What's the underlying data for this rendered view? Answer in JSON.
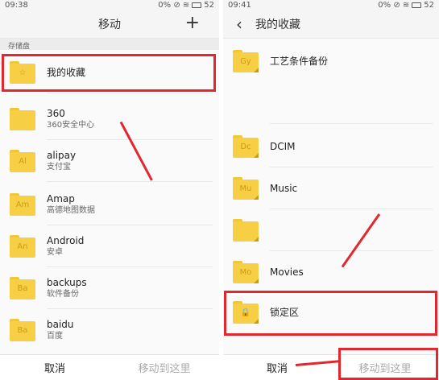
{
  "left": {
    "status": {
      "time": "09:38",
      "icons": "0% ⊘ ≋",
      "battery": "52"
    },
    "title": "移动",
    "add_icon": "+",
    "breadcrumb": "存储盘",
    "items": [
      {
        "mark": "☆",
        "name": "我的收藏",
        "sub": ""
      },
      {
        "mark": "",
        "name": "360",
        "sub": "360安全中心"
      },
      {
        "mark": "Al",
        "name": "alipay",
        "sub": "支付宝"
      },
      {
        "mark": "Am",
        "name": "Amap",
        "sub": "高德地图数据"
      },
      {
        "mark": "An",
        "name": "Android",
        "sub": "安卓"
      },
      {
        "mark": "Ba",
        "name": "backups",
        "sub": "软件备份"
      },
      {
        "mark": "Ba",
        "name": "baidu",
        "sub": "百度"
      }
    ],
    "cancel_label": "取消",
    "move_label": "移动到这里"
  },
  "right": {
    "status": {
      "time": "09:41",
      "icons": "0% ⊘ ≋",
      "battery": "52"
    },
    "back_icon": "‹",
    "title": "我的收藏",
    "items": [
      {
        "mark": "Gy",
        "name": "工艺条件备份"
      },
      {
        "mark": "Dc",
        "name": "DCIM"
      },
      {
        "mark": "Mu",
        "name": "Music"
      },
      {
        "mark": "",
        "name": ""
      },
      {
        "mark": "Mo",
        "name": "Movies"
      },
      {
        "mark": "🔒",
        "name": "锁定区"
      }
    ],
    "cancel_label": "取消",
    "move_label": "移动到这里"
  },
  "colors": {
    "highlight": "#e0282e",
    "folder": "#f7cf45",
    "folder_mark": "#c99c17"
  }
}
